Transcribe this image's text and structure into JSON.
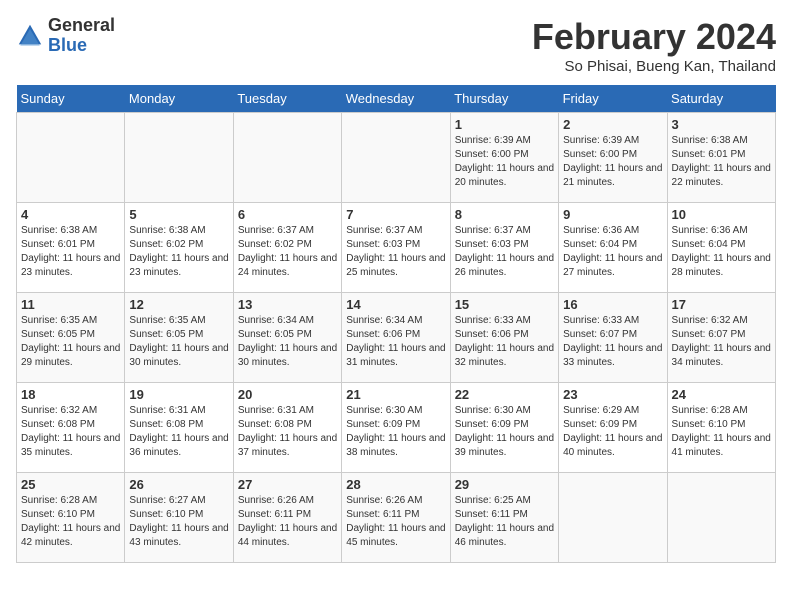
{
  "header": {
    "logo_general": "General",
    "logo_blue": "Blue",
    "title": "February 2024",
    "subtitle": "So Phisai, Bueng Kan, Thailand"
  },
  "weekdays": [
    "Sunday",
    "Monday",
    "Tuesday",
    "Wednesday",
    "Thursday",
    "Friday",
    "Saturday"
  ],
  "weeks": [
    [
      {
        "day": "",
        "sunrise": "",
        "sunset": "",
        "daylight": ""
      },
      {
        "day": "",
        "sunrise": "",
        "sunset": "",
        "daylight": ""
      },
      {
        "day": "",
        "sunrise": "",
        "sunset": "",
        "daylight": ""
      },
      {
        "day": "",
        "sunrise": "",
        "sunset": "",
        "daylight": ""
      },
      {
        "day": "1",
        "sunrise": "Sunrise: 6:39 AM",
        "sunset": "Sunset: 6:00 PM",
        "daylight": "Daylight: 11 hours and 20 minutes."
      },
      {
        "day": "2",
        "sunrise": "Sunrise: 6:39 AM",
        "sunset": "Sunset: 6:00 PM",
        "daylight": "Daylight: 11 hours and 21 minutes."
      },
      {
        "day": "3",
        "sunrise": "Sunrise: 6:38 AM",
        "sunset": "Sunset: 6:01 PM",
        "daylight": "Daylight: 11 hours and 22 minutes."
      }
    ],
    [
      {
        "day": "4",
        "sunrise": "Sunrise: 6:38 AM",
        "sunset": "Sunset: 6:01 PM",
        "daylight": "Daylight: 11 hours and 23 minutes."
      },
      {
        "day": "5",
        "sunrise": "Sunrise: 6:38 AM",
        "sunset": "Sunset: 6:02 PM",
        "daylight": "Daylight: 11 hours and 23 minutes."
      },
      {
        "day": "6",
        "sunrise": "Sunrise: 6:37 AM",
        "sunset": "Sunset: 6:02 PM",
        "daylight": "Daylight: 11 hours and 24 minutes."
      },
      {
        "day": "7",
        "sunrise": "Sunrise: 6:37 AM",
        "sunset": "Sunset: 6:03 PM",
        "daylight": "Daylight: 11 hours and 25 minutes."
      },
      {
        "day": "8",
        "sunrise": "Sunrise: 6:37 AM",
        "sunset": "Sunset: 6:03 PM",
        "daylight": "Daylight: 11 hours and 26 minutes."
      },
      {
        "day": "9",
        "sunrise": "Sunrise: 6:36 AM",
        "sunset": "Sunset: 6:04 PM",
        "daylight": "Daylight: 11 hours and 27 minutes."
      },
      {
        "day": "10",
        "sunrise": "Sunrise: 6:36 AM",
        "sunset": "Sunset: 6:04 PM",
        "daylight": "Daylight: 11 hours and 28 minutes."
      }
    ],
    [
      {
        "day": "11",
        "sunrise": "Sunrise: 6:35 AM",
        "sunset": "Sunset: 6:05 PM",
        "daylight": "Daylight: 11 hours and 29 minutes."
      },
      {
        "day": "12",
        "sunrise": "Sunrise: 6:35 AM",
        "sunset": "Sunset: 6:05 PM",
        "daylight": "Daylight: 11 hours and 30 minutes."
      },
      {
        "day": "13",
        "sunrise": "Sunrise: 6:34 AM",
        "sunset": "Sunset: 6:05 PM",
        "daylight": "Daylight: 11 hours and 30 minutes."
      },
      {
        "day": "14",
        "sunrise": "Sunrise: 6:34 AM",
        "sunset": "Sunset: 6:06 PM",
        "daylight": "Daylight: 11 hours and 31 minutes."
      },
      {
        "day": "15",
        "sunrise": "Sunrise: 6:33 AM",
        "sunset": "Sunset: 6:06 PM",
        "daylight": "Daylight: 11 hours and 32 minutes."
      },
      {
        "day": "16",
        "sunrise": "Sunrise: 6:33 AM",
        "sunset": "Sunset: 6:07 PM",
        "daylight": "Daylight: 11 hours and 33 minutes."
      },
      {
        "day": "17",
        "sunrise": "Sunrise: 6:32 AM",
        "sunset": "Sunset: 6:07 PM",
        "daylight": "Daylight: 11 hours and 34 minutes."
      }
    ],
    [
      {
        "day": "18",
        "sunrise": "Sunrise: 6:32 AM",
        "sunset": "Sunset: 6:08 PM",
        "daylight": "Daylight: 11 hours and 35 minutes."
      },
      {
        "day": "19",
        "sunrise": "Sunrise: 6:31 AM",
        "sunset": "Sunset: 6:08 PM",
        "daylight": "Daylight: 11 hours and 36 minutes."
      },
      {
        "day": "20",
        "sunrise": "Sunrise: 6:31 AM",
        "sunset": "Sunset: 6:08 PM",
        "daylight": "Daylight: 11 hours and 37 minutes."
      },
      {
        "day": "21",
        "sunrise": "Sunrise: 6:30 AM",
        "sunset": "Sunset: 6:09 PM",
        "daylight": "Daylight: 11 hours and 38 minutes."
      },
      {
        "day": "22",
        "sunrise": "Sunrise: 6:30 AM",
        "sunset": "Sunset: 6:09 PM",
        "daylight": "Daylight: 11 hours and 39 minutes."
      },
      {
        "day": "23",
        "sunrise": "Sunrise: 6:29 AM",
        "sunset": "Sunset: 6:09 PM",
        "daylight": "Daylight: 11 hours and 40 minutes."
      },
      {
        "day": "24",
        "sunrise": "Sunrise: 6:28 AM",
        "sunset": "Sunset: 6:10 PM",
        "daylight": "Daylight: 11 hours and 41 minutes."
      }
    ],
    [
      {
        "day": "25",
        "sunrise": "Sunrise: 6:28 AM",
        "sunset": "Sunset: 6:10 PM",
        "daylight": "Daylight: 11 hours and 42 minutes."
      },
      {
        "day": "26",
        "sunrise": "Sunrise: 6:27 AM",
        "sunset": "Sunset: 6:10 PM",
        "daylight": "Daylight: 11 hours and 43 minutes."
      },
      {
        "day": "27",
        "sunrise": "Sunrise: 6:26 AM",
        "sunset": "Sunset: 6:11 PM",
        "daylight": "Daylight: 11 hours and 44 minutes."
      },
      {
        "day": "28",
        "sunrise": "Sunrise: 6:26 AM",
        "sunset": "Sunset: 6:11 PM",
        "daylight": "Daylight: 11 hours and 45 minutes."
      },
      {
        "day": "29",
        "sunrise": "Sunrise: 6:25 AM",
        "sunset": "Sunset: 6:11 PM",
        "daylight": "Daylight: 11 hours and 46 minutes."
      },
      {
        "day": "",
        "sunrise": "",
        "sunset": "",
        "daylight": ""
      },
      {
        "day": "",
        "sunrise": "",
        "sunset": "",
        "daylight": ""
      }
    ]
  ]
}
